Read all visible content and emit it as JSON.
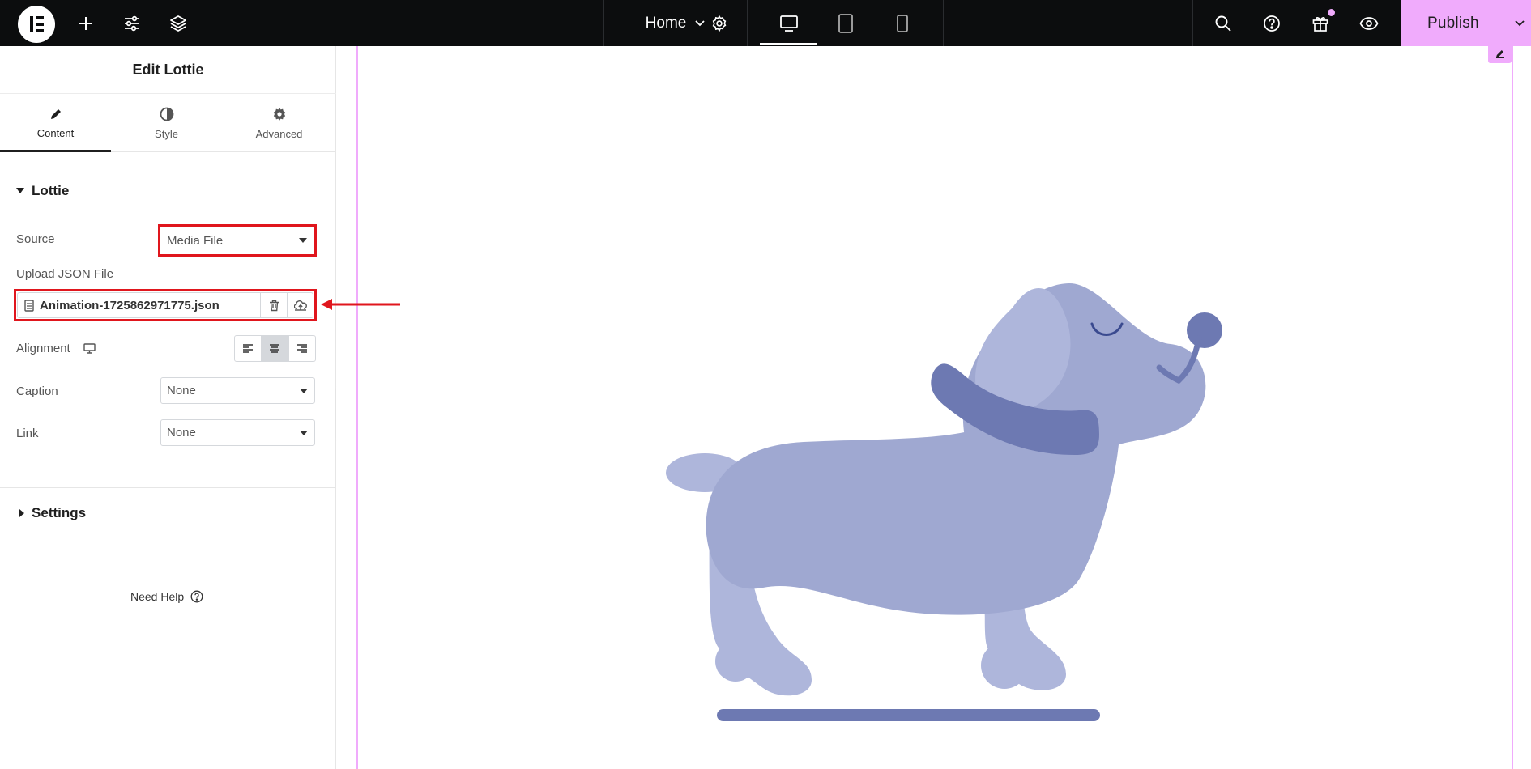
{
  "topbar": {
    "home_label": "Home",
    "publish_label": "Publish"
  },
  "panel": {
    "title": "Edit Lottie",
    "tabs": [
      {
        "label": "Content",
        "icon": "pencil-icon",
        "active": true
      },
      {
        "label": "Style",
        "icon": "half-circle-icon",
        "active": false
      },
      {
        "label": "Advanced",
        "icon": "gear-icon",
        "active": false
      }
    ],
    "lottie_section": {
      "title": "Lottie",
      "source_label": "Source",
      "source_value": "Media File",
      "upload_label": "Upload JSON File",
      "file_name": "Animation-1725862971775.json",
      "alignment_label": "Alignment",
      "caption_label": "Caption",
      "caption_value": "None",
      "link_label": "Link",
      "link_value": "None"
    },
    "settings_section": {
      "title": "Settings"
    },
    "help_label": "Need Help"
  },
  "colors": {
    "accent": "#f0abfc",
    "highlight": "#e0161d",
    "dog_body": "#9fa8d1",
    "dog_dark": "#6d79b2"
  }
}
